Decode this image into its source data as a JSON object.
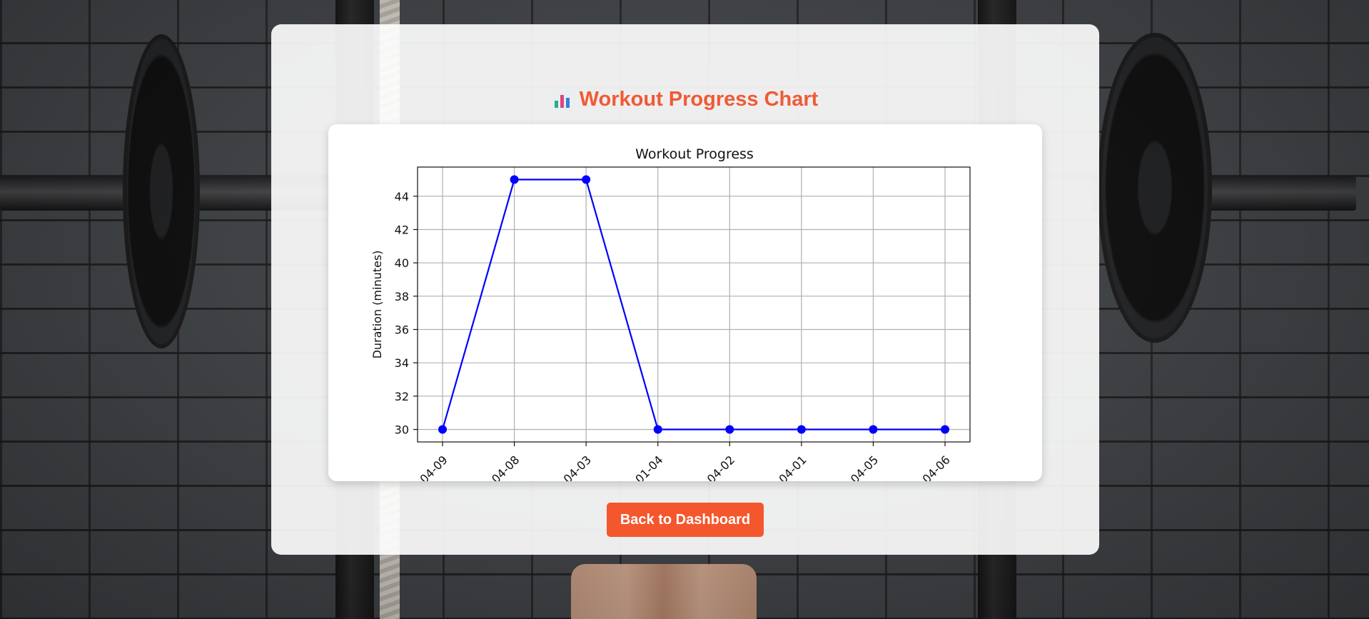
{
  "page": {
    "title": "Workout Progress Chart",
    "title_icon": "bar-chart-icon",
    "accent_color": "#f05a35",
    "button_color": "#f4572d"
  },
  "actions": {
    "back_label": "Back to Dashboard"
  },
  "chart_data": {
    "type": "line",
    "title": "Workout Progress",
    "xlabel": "",
    "ylabel": "Duration (minutes)",
    "categories": [
      "04-09",
      "04-08",
      "04-03",
      "01-04",
      "04-02",
      "04-01",
      "04-05",
      "04-06"
    ],
    "series": [
      {
        "values": [
          30,
          45,
          45,
          30,
          30,
          30,
          30,
          30
        ]
      }
    ],
    "yticks": [
      30,
      32,
      34,
      36,
      38,
      40,
      42,
      44
    ],
    "ylim": [
      29.25,
      45.75
    ],
    "grid": true,
    "line_color": "#0000ff",
    "marker": "circle",
    "xtick_rotation": "45 degrees"
  }
}
